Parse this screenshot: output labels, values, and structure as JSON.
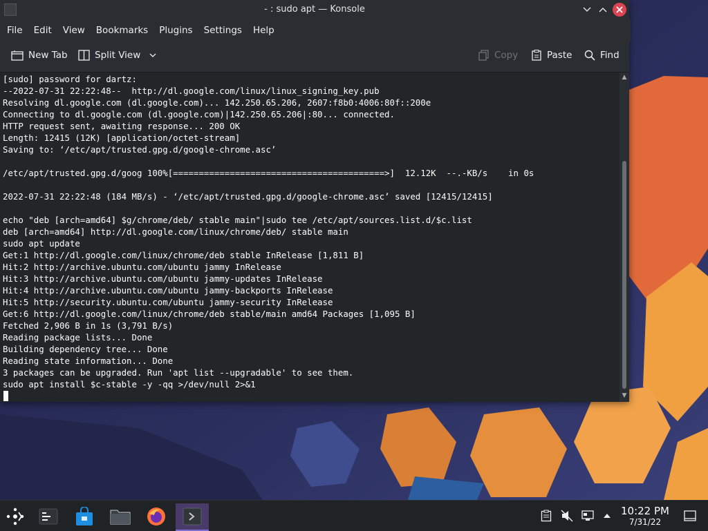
{
  "window": {
    "title": "- : sudo apt — Konsole"
  },
  "menu": {
    "items": [
      "File",
      "Edit",
      "View",
      "Bookmarks",
      "Plugins",
      "Settings",
      "Help"
    ]
  },
  "toolbar": {
    "new_tab": "New Tab",
    "split_view": "Split View",
    "copy": "Copy",
    "paste": "Paste",
    "find": "Find"
  },
  "terminal": {
    "lines": [
      "[sudo] password for dartz:",
      "--2022-07-31 22:22:48--  http://dl.google.com/linux/linux_signing_key.pub",
      "Resolving dl.google.com (dl.google.com)... 142.250.65.206, 2607:f8b0:4006:80f::200e",
      "Connecting to dl.google.com (dl.google.com)|142.250.65.206|:80... connected.",
      "HTTP request sent, awaiting response... 200 OK",
      "Length: 12415 (12K) [application/octet-stream]",
      "Saving to: ‘/etc/apt/trusted.gpg.d/google-chrome.asc’",
      "",
      "/etc/apt/trusted.gpg.d/goog 100%[=========================================>]  12.12K  --.-KB/s    in 0s",
      "",
      "2022-07-31 22:22:48 (184 MB/s) - ‘/etc/apt/trusted.gpg.d/google-chrome.asc’ saved [12415/12415]",
      "",
      "echo \"deb [arch=amd64] $g/chrome/deb/ stable main\"|sudo tee /etc/apt/sources.list.d/$c.list",
      "deb [arch=amd64] http://dl.google.com/linux/chrome/deb/ stable main",
      "sudo apt update",
      "Get:1 http://dl.google.com/linux/chrome/deb stable InRelease [1,811 B]",
      "Hit:2 http://archive.ubuntu.com/ubuntu jammy InRelease",
      "Hit:3 http://archive.ubuntu.com/ubuntu jammy-updates InRelease",
      "Hit:4 http://archive.ubuntu.com/ubuntu jammy-backports InRelease",
      "Hit:5 http://security.ubuntu.com/ubuntu jammy-security InRelease",
      "Get:6 http://dl.google.com/linux/chrome/deb stable/main amd64 Packages [1,095 B]",
      "Fetched 2,906 B in 1s (3,791 B/s)",
      "Reading package lists... Done",
      "Building dependency tree... Done",
      "Reading state information... Done",
      "3 packages can be upgraded. Run 'apt list --upgradable' to see them.",
      "sudo apt install $c-stable -y -qq >/dev/null 2>&1"
    ]
  },
  "taskbar": {
    "apps": [
      "application-launcher-icon",
      "task-overview-icon",
      "discover-store-icon",
      "dolphin-files-icon",
      "firefox-icon",
      "konsole-icon"
    ],
    "clock_time": "10:22 PM",
    "clock_date": "7/31/22"
  },
  "colors": {
    "accent": "#7c6fd1",
    "close": "#da4453",
    "terminal_bg": "#232629"
  }
}
